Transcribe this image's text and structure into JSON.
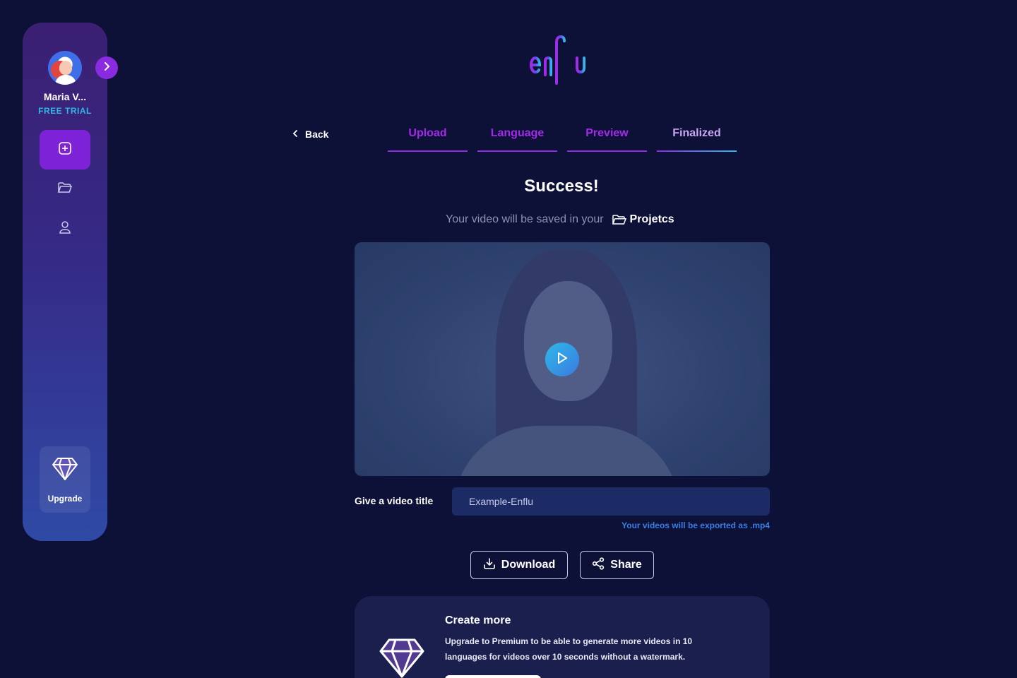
{
  "brand": {
    "logo_text": "enflu"
  },
  "user": {
    "name": "Maria V...",
    "plan": "FREE TRIAL"
  },
  "sidebar": {
    "items": [
      {
        "icon": "plus-square-icon",
        "active": true
      },
      {
        "icon": "folder-icon",
        "active": false
      },
      {
        "icon": "user-icon",
        "active": false
      }
    ],
    "upgrade_label": "Upgrade"
  },
  "nav": {
    "back_label": "Back",
    "tabs": [
      {
        "label": "Upload",
        "state": "done"
      },
      {
        "label": "Language",
        "state": "done"
      },
      {
        "label": "Preview",
        "state": "done"
      },
      {
        "label": "Finalized",
        "state": "current"
      }
    ]
  },
  "main": {
    "title": "Success!",
    "saved_prefix": "Your video will be saved in your",
    "saved_folder": "Projetcs",
    "video_title_label": "Give a video title",
    "video_title_value": "Example-Enflu",
    "export_note": "Your videos will be exported as .mp4",
    "download_label": "Download",
    "share_label": "Share"
  },
  "promo": {
    "title": "Create more",
    "text": "Upgrade to Premium to be able to generate more videos in 10 languages for videos over 10 seconds without a watermark."
  },
  "colors": {
    "background": "#0d1138",
    "accent_purple": "#8f2de0",
    "accent_cyan": "#2fb8e8",
    "input_bg": "#1c2a66"
  }
}
